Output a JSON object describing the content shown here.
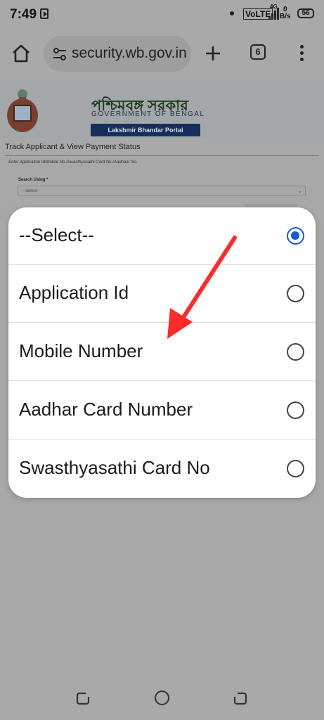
{
  "status_bar": {
    "time": "7:49",
    "volte": "VoLTE",
    "network_gen": "4G",
    "net_speed_value": "0",
    "net_speed_unit": "B/s",
    "battery": "56"
  },
  "browser": {
    "url": "security.wb.gov.in",
    "tab_count": "6",
    "icons": [
      "home-icon",
      "site-settings-icon",
      "new-tab-plus-icon",
      "tab-switcher-icon",
      "overflow-menu-icon"
    ]
  },
  "page": {
    "gov_bengali": "পশ্চিমবঙ্গ সরকার",
    "gov_english": "GOVERNMENT OF BENGAL",
    "portal_name": "Lakshmir Bhandar Portal",
    "track_heading": "Track Applicant & View Payment Status",
    "enter_hint": "Enter Application Id/Mobile No./Swasthyasathi Card No./Aadhaar No.",
    "search_label": "Search Using *",
    "select_value": "--Select--"
  },
  "sheet": {
    "options": [
      {
        "label": "--Select--",
        "selected": true
      },
      {
        "label": "Application Id",
        "selected": false
      },
      {
        "label": "Mobile Number",
        "selected": false
      },
      {
        "label": "Aadhar Card Number",
        "selected": false
      },
      {
        "label": "Swasthyasathi Card No",
        "selected": false
      }
    ]
  },
  "colors": {
    "accent": "#1a5bd6",
    "annotation_arrow": "#ff2a2a",
    "portal_tag": "#162f5a"
  }
}
